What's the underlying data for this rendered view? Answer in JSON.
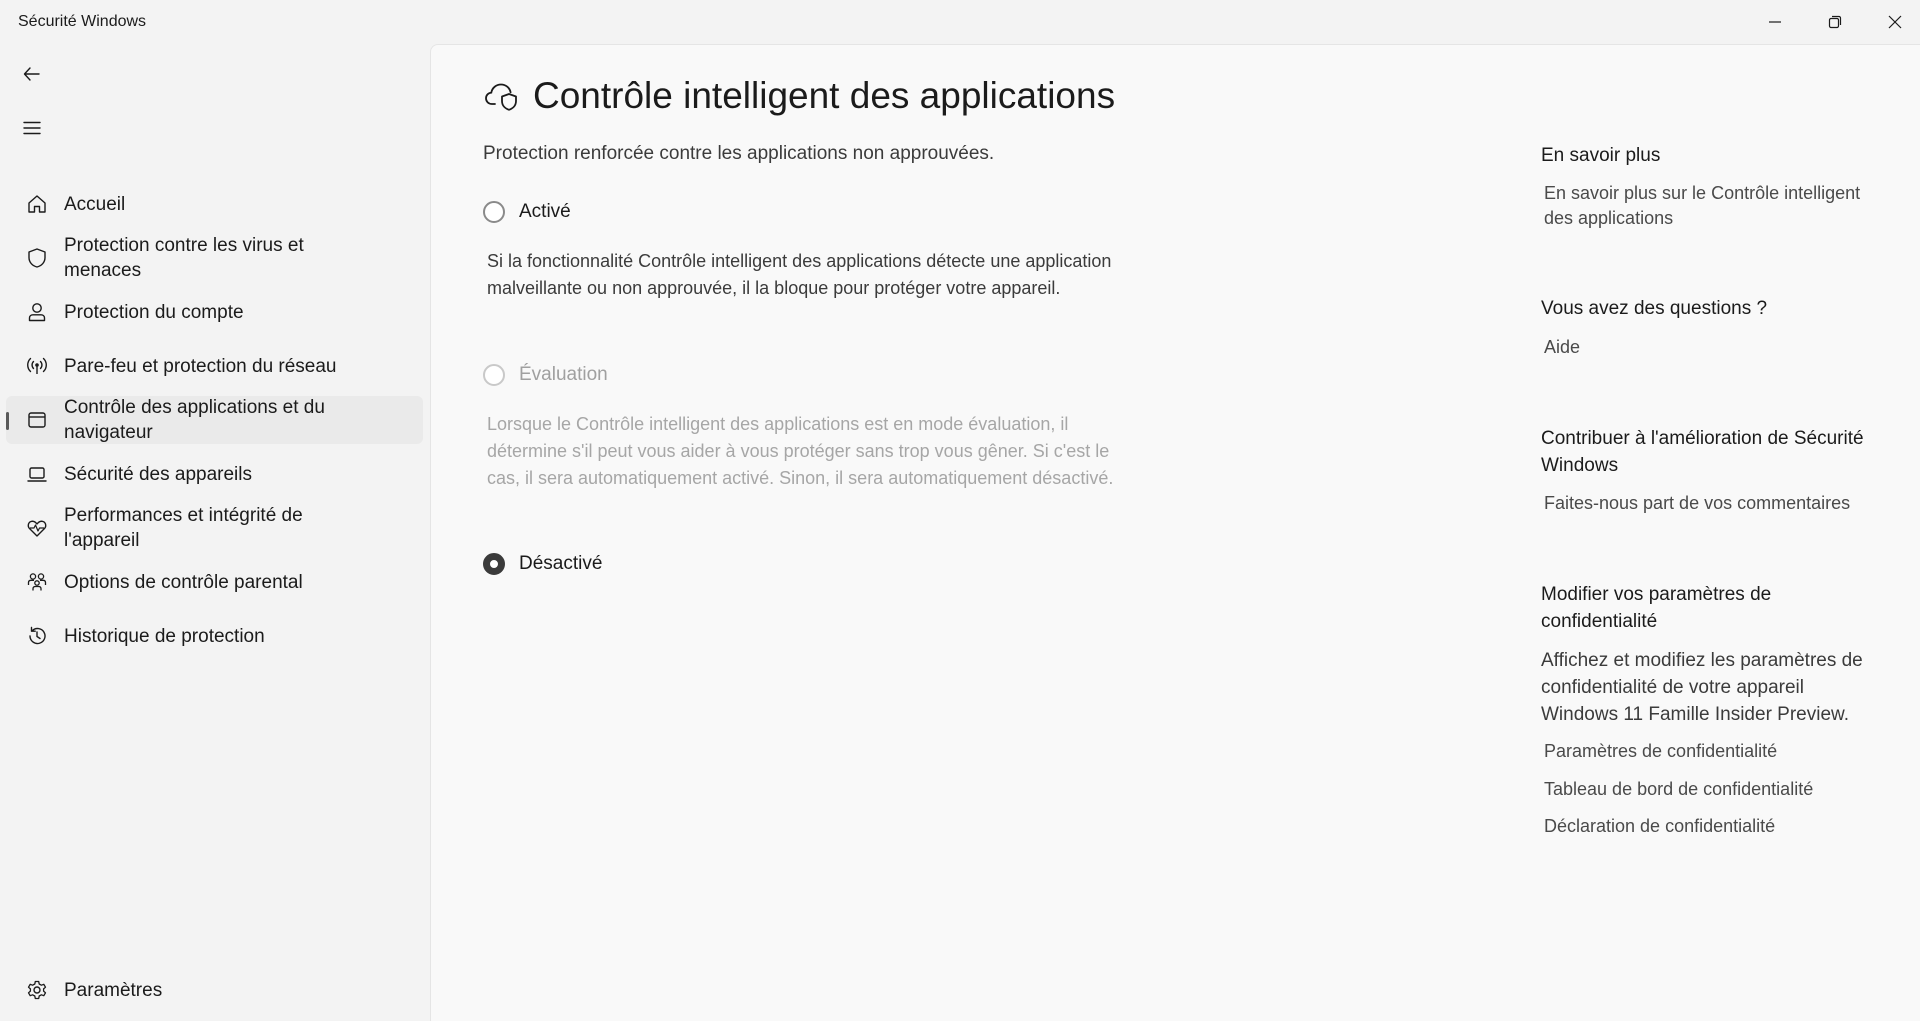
{
  "window": {
    "title": "Sécurité Windows",
    "minimize_icon": "minimize-icon",
    "maximize_icon": "restore-icon",
    "close_icon": "close-icon"
  },
  "sidebar": {
    "back_icon": "back-arrow-icon",
    "menu_icon": "hamburger-menu-icon",
    "items": [
      {
        "label": "Accueil",
        "icon": "home-icon"
      },
      {
        "label": "Protection contre les virus et menaces",
        "icon": "shield-icon"
      },
      {
        "label": "Protection du compte",
        "icon": "person-icon"
      },
      {
        "label": "Pare-feu et protection du réseau",
        "icon": "wireless-icon"
      },
      {
        "label": "Contrôle des applications et du navigateur",
        "icon": "browser-window-icon",
        "selected": true
      },
      {
        "label": "Sécurité des appareils",
        "icon": "laptop-icon"
      },
      {
        "label": "Performances et intégrité de l'appareil",
        "icon": "heart-pulse-icon"
      },
      {
        "label": "Options de contrôle parental",
        "icon": "family-icon"
      },
      {
        "label": "Historique de protection",
        "icon": "history-icon"
      }
    ],
    "settings_label": "Paramètres",
    "settings_icon": "gear-icon"
  },
  "main": {
    "title": "Contrôle intelligent des applications",
    "title_icon": "cloud-shield-icon",
    "subtitle": "Protection renforcée contre les applications non approuvées.",
    "options": [
      {
        "label": "Activé",
        "checked": false,
        "disabled": false,
        "description": "Si la fonctionnalité Contrôle intelligent des applications détecte une application malveillante ou non approuvée, il la bloque pour protéger votre appareil."
      },
      {
        "label": "Évaluation",
        "checked": false,
        "disabled": true,
        "description": "Lorsque le Contrôle intelligent des applications est en mode évaluation, il détermine s'il peut vous aider à vous protéger sans trop vous gêner. Si c'est le cas, il sera automatiquement activé. Sinon, il sera automatiquement désactivé."
      },
      {
        "label": "Désactivé",
        "checked": true,
        "disabled": false
      }
    ]
  },
  "right": {
    "learn_more_heading": "En savoir plus",
    "learn_more_link": "En savoir plus sur le Contrôle intelligent des applications",
    "questions_heading": "Vous avez des questions ?",
    "help_link": "Aide",
    "feedback_heading": "Contribuer à l'amélioration de Sécurité Windows",
    "feedback_link": "Faites-nous part de vos commentaires",
    "privacy_heading": "Modifier vos paramètres de confidentialité",
    "privacy_text": "Affichez et modifiez les paramètres de confidentialité de votre appareil Windows 11 Famille Insider Preview.",
    "privacy_links": [
      "Paramètres de confidentialité",
      "Tableau de bord de confidentialité",
      "Déclaration de confidentialité"
    ]
  }
}
